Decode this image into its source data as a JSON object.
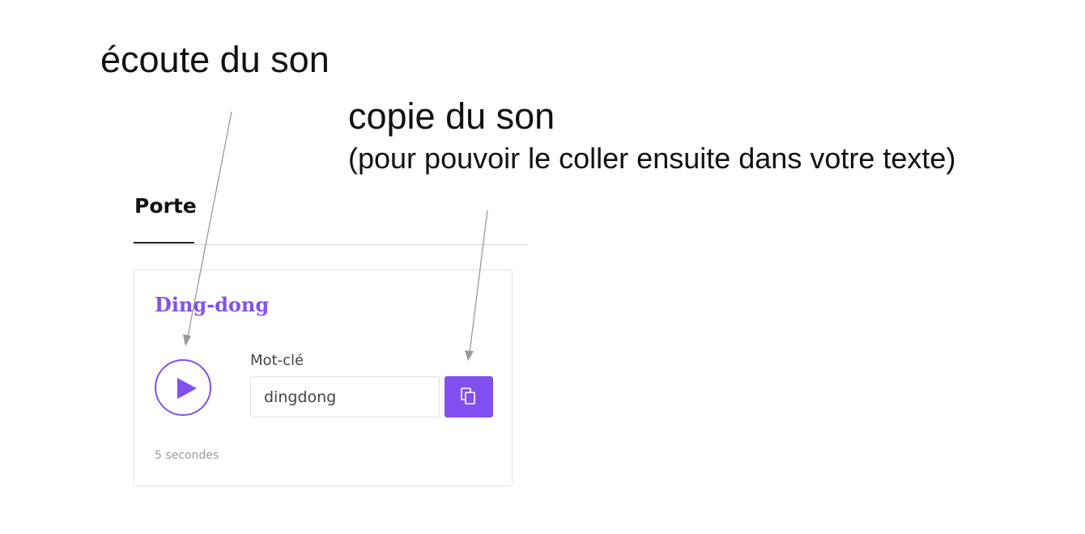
{
  "annotations": {
    "listen": "écoute du son",
    "copy_title": "copie du son",
    "copy_subtitle": "(pour pouvoir le coller ensuite dans votre texte)"
  },
  "tabs": {
    "active_label": "Porte"
  },
  "sound_card": {
    "title": "Ding-dong",
    "play_icon": "play-icon",
    "keyword_label": "Mot-clé",
    "keyword_value": "dingdong",
    "copy_icon": "copy-icon",
    "duration": "5 secondes"
  },
  "colors": {
    "accent": "#8250f0",
    "annotation_arrow": "#999999"
  }
}
